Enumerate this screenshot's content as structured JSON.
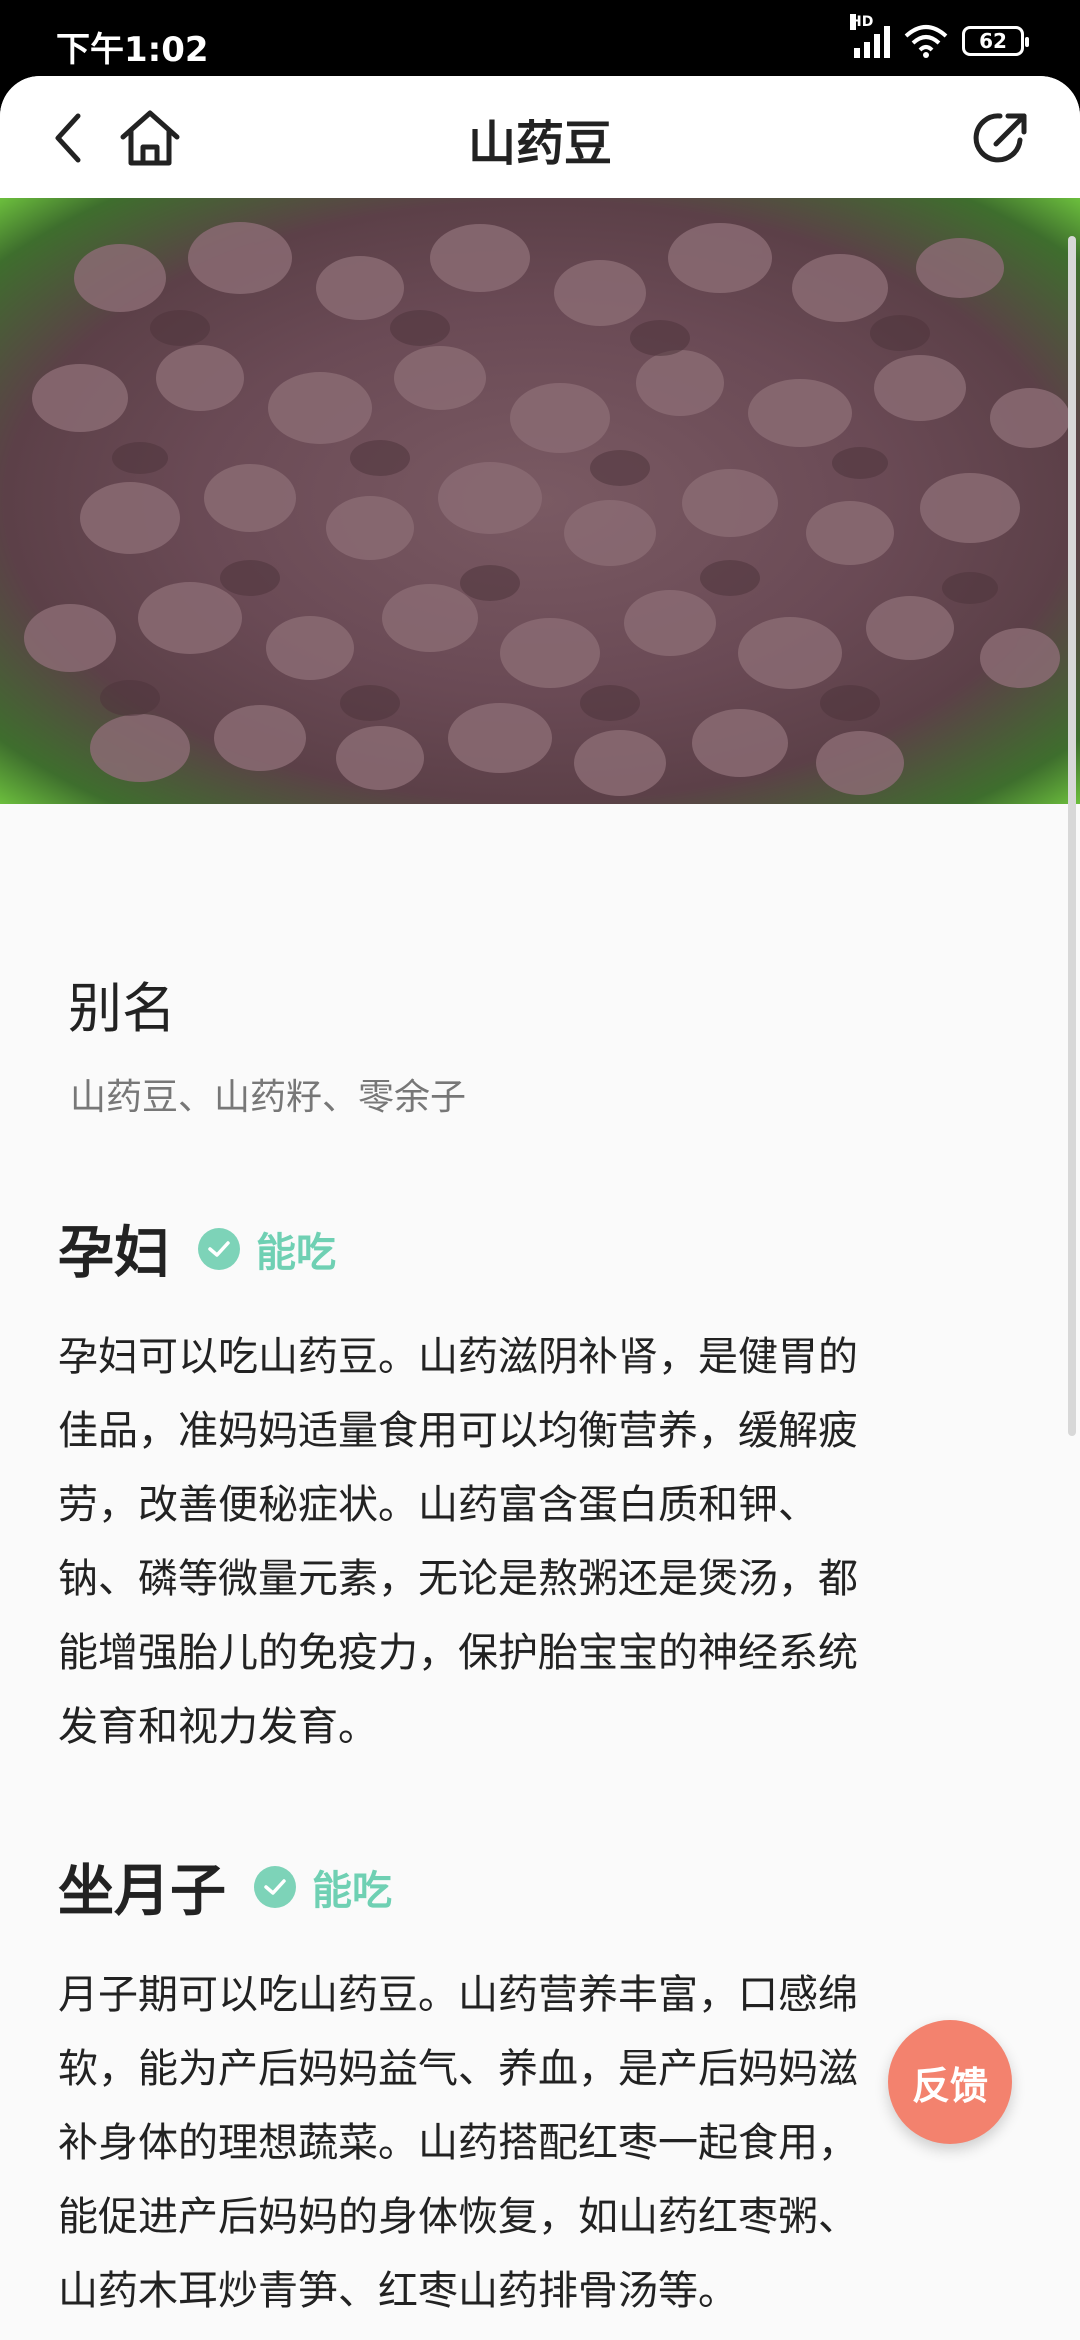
{
  "status_bar": {
    "time": "下午1:02",
    "network": "HD",
    "battery": "62"
  },
  "nav": {
    "title": "山药豆"
  },
  "alias": {
    "title": "别名",
    "text": "山药豆、山药籽、零余子"
  },
  "sections": [
    {
      "heading": "孕妇",
      "badge": "能吃",
      "lines": [
        "孕妇可以吃山药豆。山药滋阴补肾，是健胃的",
        "佳品，准妈妈适量食用可以均衡营养，缓解疲",
        "劳，改善便秘症状。山药富含蛋白质和钾、",
        "钠、磷等微量元素，无论是熬粥还是煲汤，都",
        "能增强胎儿的免疫力，保护胎宝宝的神经系统",
        "发育和视力发育。"
      ]
    },
    {
      "heading": "坐月子",
      "badge": "能吃",
      "lines": [
        "月子期可以吃山药豆。山药营养丰富，口感绵",
        "软，能为产后妈妈益气、养血，是产后妈妈滋",
        "补身体的理想蔬菜。山药搭配红枣一起食用，",
        "能促进产后妈妈的身体恢复，如山药红枣粥、",
        "山药木耳炒青笋、红枣山药排骨汤等。"
      ]
    }
  ],
  "feedback_button": "反馈",
  "colors": {
    "accent_green": "#6fd0b3",
    "feedback": "#f3826e"
  }
}
